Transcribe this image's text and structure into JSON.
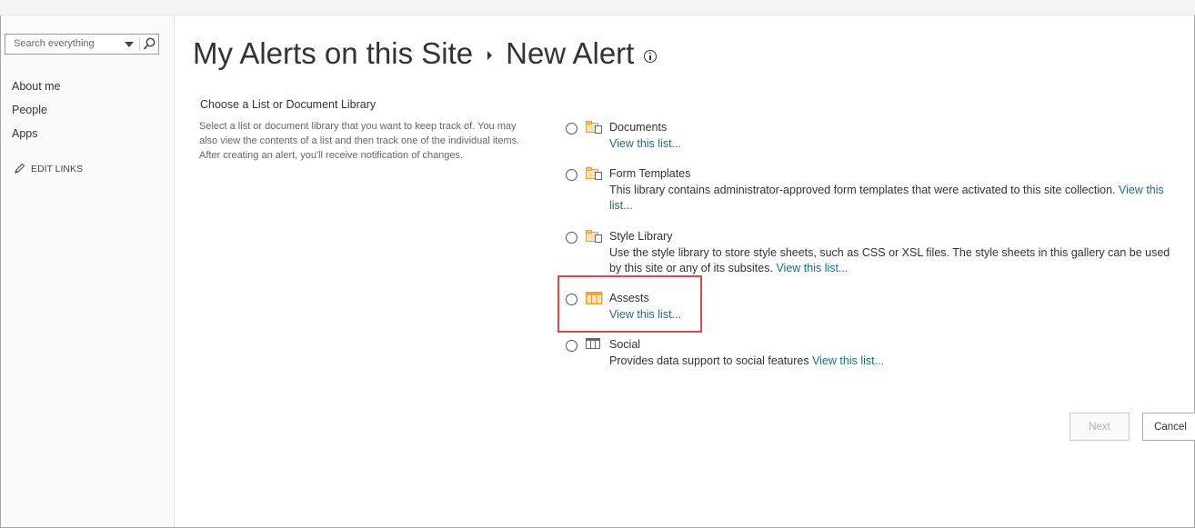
{
  "search": {
    "placeholder": "Search everything"
  },
  "nav": {
    "items": [
      {
        "label": "About me"
      },
      {
        "label": "People"
      },
      {
        "label": "Apps"
      }
    ],
    "edit_links": "EDIT LINKS"
  },
  "breadcrumb": {
    "parent": "My Alerts on this Site",
    "current": "New Alert"
  },
  "section": {
    "title": "Choose a List or Document Library",
    "description": "Select a list or document library that you want to keep track of. You may also view the contents of a list and then track one of the individual items. After creating an alert, you'll receive notification of changes."
  },
  "options": [
    {
      "name": "Documents",
      "description": "",
      "link": "View this list...",
      "icon": "document-library-icon"
    },
    {
      "name": "Form Templates",
      "description": "This library contains administrator-approved form templates that were activated to this site collection.",
      "link": "View this list...",
      "icon": "document-library-icon"
    },
    {
      "name": "Style Library",
      "description": "Use the style library to store style sheets, such as CSS or XSL files. The style sheets in this gallery can be used by this site or any of its subsites.",
      "link": "View this list...",
      "icon": "document-library-icon"
    },
    {
      "name": "Assests",
      "description": "",
      "link": "View this list...",
      "icon": "list-table-icon"
    },
    {
      "name": "Social",
      "description": "Provides data support to social features",
      "link": "View this list...",
      "icon": "list-table-icon"
    }
  ],
  "buttons": {
    "next": "Next",
    "cancel": "Cancel"
  },
  "colors": {
    "link": "#1c6d80",
    "highlight": "#e0484a",
    "icon_orange": "#f0a030"
  }
}
